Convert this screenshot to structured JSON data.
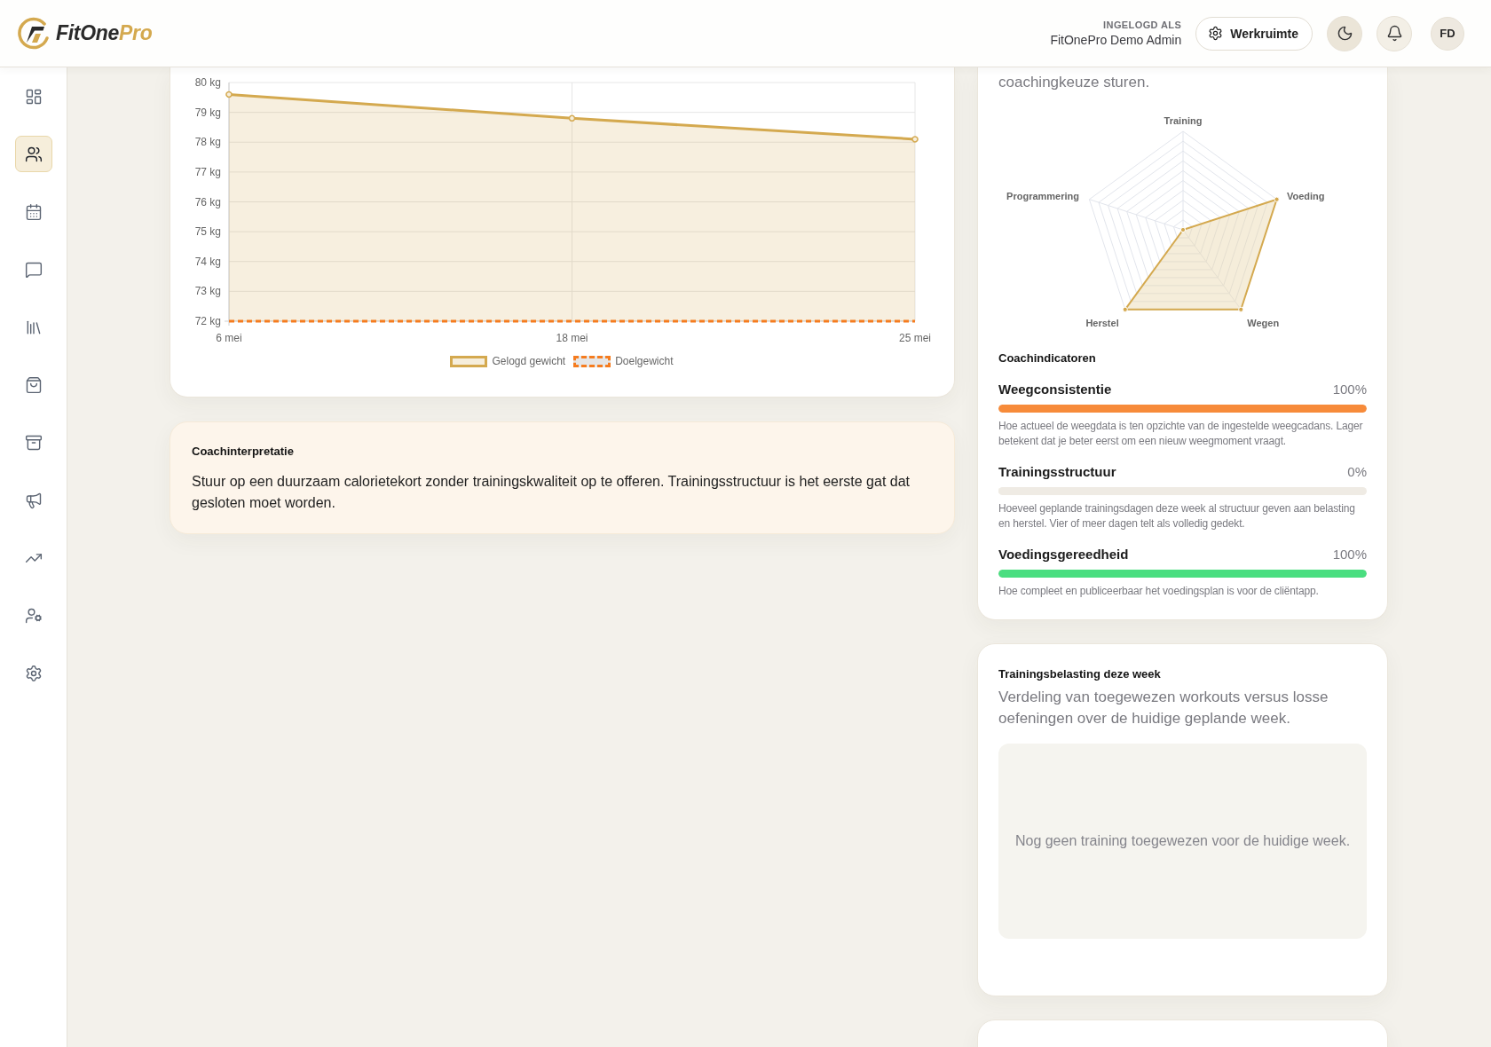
{
  "header": {
    "logo": {
      "name": "FitOne",
      "suffix": "Pro"
    },
    "user_label": "INGELOGD ALS",
    "user_name": "FitOnePro Demo Admin",
    "workspace_button": "Werkruimte",
    "avatar": "FD"
  },
  "sidebar": {
    "items": [
      {
        "selected": false
      },
      {
        "selected": true
      },
      {
        "selected": false
      },
      {
        "selected": false
      },
      {
        "selected": false
      },
      {
        "selected": false
      },
      {
        "selected": false
      },
      {
        "selected": false
      },
      {
        "selected": false
      },
      {
        "selected": false
      },
      {
        "selected": false
      }
    ]
  },
  "weight_card": {
    "chart_data": {
      "type": "line",
      "grid": true,
      "categories": [
        "6 mei",
        "18 mei",
        "25 mei"
      ],
      "series": [
        {
          "name": "Gelogd gewicht",
          "color": "#d4a94f",
          "values": [
            79.6,
            78.8,
            78.1
          ],
          "type": "area"
        },
        {
          "name": "Doelgewicht",
          "color": "#f57c1f",
          "values": [
            72,
            72,
            72
          ],
          "line_style": "dashed"
        }
      ],
      "ylim": [
        72,
        80
      ],
      "yticks": [
        {
          "value": 72,
          "label": "72 kg"
        },
        {
          "value": 73,
          "label": "73 kg"
        },
        {
          "value": 74,
          "label": "74 kg"
        },
        {
          "value": 75,
          "label": "75 kg"
        },
        {
          "value": 76,
          "label": "76 kg"
        },
        {
          "value": 77,
          "label": "77 kg"
        },
        {
          "value": 78,
          "label": "78 kg"
        },
        {
          "value": 79,
          "label": "79 kg"
        },
        {
          "value": 80,
          "label": "80 kg"
        }
      ]
    }
  },
  "interpretation": {
    "title": "Coachinterpretatie",
    "text": "Stuur op een duurzaam calorietekort zonder trainingskwaliteit op te offeren. Trainingsstructuur is het eerste gat dat gesloten moet worden."
  },
  "coaching_card": {
    "intro": "coachingkeuze sturen.",
    "radar": {
      "axes": [
        {
          "label": "Training"
        },
        {
          "label": "Voeding"
        },
        {
          "label": "Wegen"
        },
        {
          "label": "Herstel"
        },
        {
          "label": "Programmering"
        }
      ]
    },
    "indicators_title": "Coachindicatoren",
    "indicators": [
      {
        "label": "Weegconsistentie",
        "value": "100%",
        "level": 1,
        "color": "#f78b3a",
        "description": "Hoe actueel de weegdata is ten opzichte van de ingestelde weegcadans. Lager betekent dat je beter eerst om een nieuw weegmoment vraagt."
      },
      {
        "label": "Trainingsstructuur",
        "value": "0%",
        "level": 0,
        "description": "Hoeveel geplande trainingsdagen deze week al structuur geven aan belasting en herstel. Vier of meer dagen telt als volledig gedekt."
      },
      {
        "label": "Voedingsgereedheid",
        "value": "100%",
        "level": 1,
        "color": "#4ade80",
        "description": "Hoe compleet en publiceerbaar het voedingsplan is voor de cliëntapp."
      }
    ]
  },
  "training_load": {
    "title": "Trainingsbelasting deze week",
    "subtitle": "Verdeling van toegewezen workouts versus losse oefeningen over de huidige geplande week.",
    "empty_message": "Nog geen training toegewezen voor de huidige week."
  }
}
